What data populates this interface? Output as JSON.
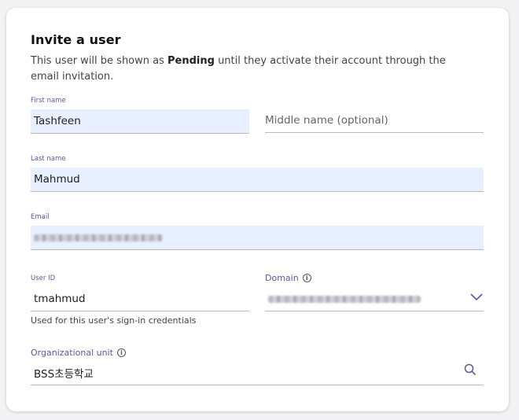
{
  "form": {
    "title": "Invite a user",
    "description_before": "This user will be shown as ",
    "description_bold": "Pending",
    "description_after": " until they activate their account through the email invitation.",
    "first_name": {
      "label": "First name",
      "value": "Tashfeen"
    },
    "middle_name": {
      "placeholder": "Middle name (optional)"
    },
    "last_name": {
      "label": "Last name",
      "value": "Mahmud"
    },
    "email": {
      "label": "Email"
    },
    "user_id": {
      "label": "User ID",
      "value": "tmahmud",
      "hint": "Used for this user's sign-in credentials"
    },
    "domain": {
      "label": "Domain"
    },
    "org_unit": {
      "label": "Organizational unit",
      "value": "BSS초등학교"
    }
  },
  "colors": {
    "accent": "#5a5a9a",
    "filled_bg": "#e8efff"
  },
  "icons": {
    "info": "info-icon",
    "dropdown": "chevron-down-icon",
    "search": "search-icon"
  }
}
